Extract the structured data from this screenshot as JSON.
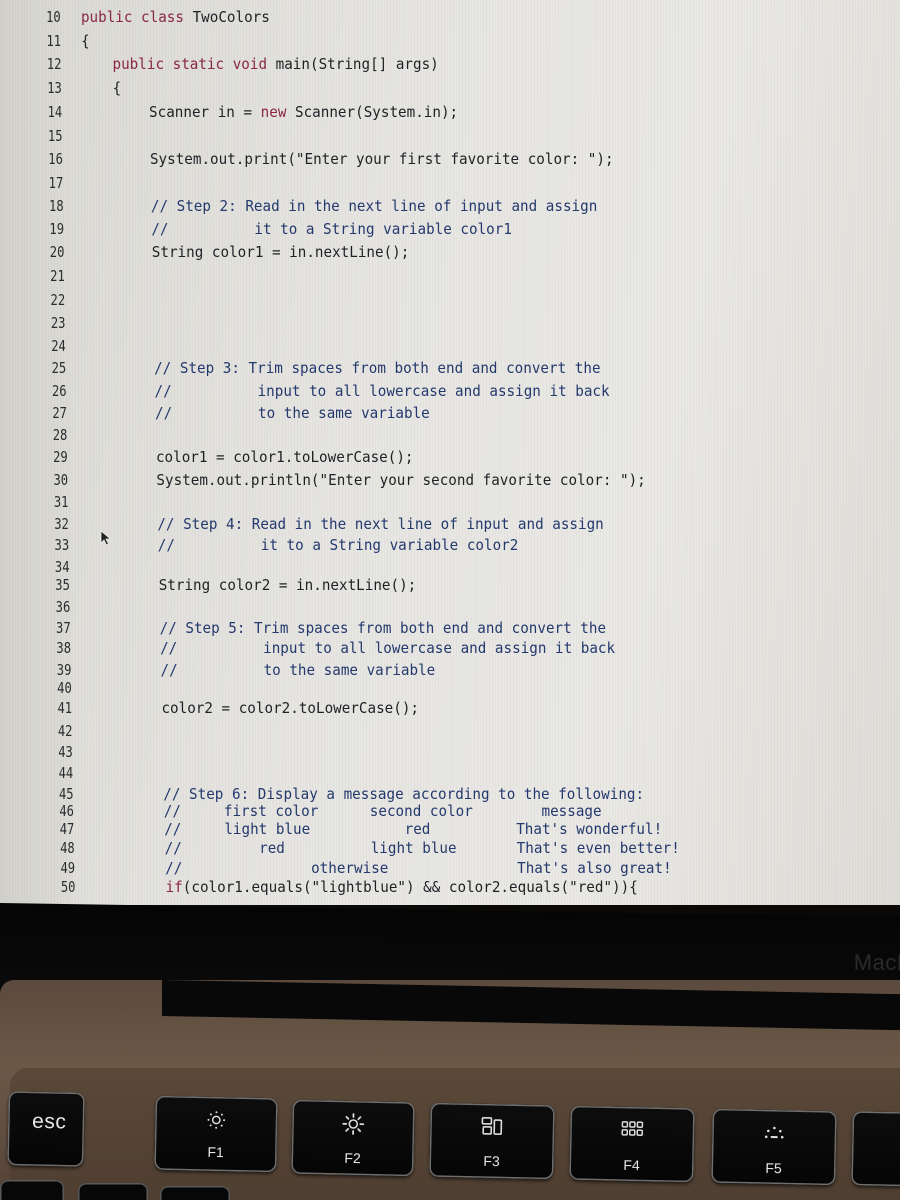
{
  "editor": {
    "language": "Java",
    "lines": [
      {
        "n": "10",
        "segments": [
          {
            "t": "public class ",
            "c": "kw"
          },
          {
            "t": "TwoColors",
            "c": "tx"
          }
        ],
        "indent": 0
      },
      {
        "n": "11",
        "segments": [
          {
            "t": "{",
            "c": "tx"
          }
        ],
        "indent": 0
      },
      {
        "n": "12",
        "segments": [
          {
            "t": "public static void ",
            "c": "kw"
          },
          {
            "t": "main(String[] args)",
            "c": "tx"
          }
        ],
        "indent": 1
      },
      {
        "n": "13",
        "segments": [
          {
            "t": "{",
            "c": "tx"
          }
        ],
        "indent": 1
      },
      {
        "n": "14",
        "segments": [
          {
            "t": "Scanner in = ",
            "c": "tx"
          },
          {
            "t": "new",
            "c": "kw"
          },
          {
            "t": " Scanner(System.in);",
            "c": "tx"
          }
        ],
        "indent": 2
      },
      {
        "n": "15",
        "segments": [],
        "indent": 2
      },
      {
        "n": "16",
        "segments": [
          {
            "t": "System.out.print(\"Enter your first favorite color: \");",
            "c": "tx"
          }
        ],
        "indent": 2
      },
      {
        "n": "17",
        "segments": [],
        "indent": 2
      },
      {
        "n": "18",
        "segments": [
          {
            "t": "// Step 2: Read in the next line of input and assign",
            "c": "cm"
          }
        ],
        "indent": 2
      },
      {
        "n": "19",
        "segments": [
          {
            "t": "//          it to a String variable color1",
            "c": "cm"
          }
        ],
        "indent": 2
      },
      {
        "n": "20",
        "segments": [
          {
            "t": "String color1 = in.nextLine();",
            "c": "tx"
          }
        ],
        "indent": 2
      },
      {
        "n": "21",
        "segments": [],
        "indent": 2
      },
      {
        "n": "22",
        "segments": [],
        "indent": 2
      },
      {
        "n": "23",
        "segments": [],
        "indent": 2
      },
      {
        "n": "24",
        "segments": [],
        "indent": 2
      },
      {
        "n": "25",
        "segments": [
          {
            "t": "// Step 3: Trim spaces from both end and convert the",
            "c": "cm"
          }
        ],
        "indent": 2
      },
      {
        "n": "26",
        "segments": [
          {
            "t": "//          input to all lowercase and assign it back",
            "c": "cm"
          }
        ],
        "indent": 2
      },
      {
        "n": "27",
        "segments": [
          {
            "t": "//          to the same variable",
            "c": "cm"
          }
        ],
        "indent": 2
      },
      {
        "n": "28",
        "segments": [],
        "indent": 2
      },
      {
        "n": "29",
        "segments": [
          {
            "t": "color1 = color1.toLowerCase();",
            "c": "tx"
          }
        ],
        "indent": 2
      },
      {
        "n": "30",
        "segments": [
          {
            "t": "System.out.println(\"Enter your second favorite color: \");",
            "c": "tx"
          }
        ],
        "indent": 2
      },
      {
        "n": "31",
        "segments": [],
        "indent": 2
      },
      {
        "n": "32",
        "segments": [
          {
            "t": "// Step 4: Read in the next line of input and assign",
            "c": "cm"
          }
        ],
        "indent": 2
      },
      {
        "n": "33",
        "segments": [
          {
            "t": "//          it to a String variable color2",
            "c": "cm"
          }
        ],
        "indent": 2
      },
      {
        "n": "34",
        "segments": [],
        "indent": 2
      },
      {
        "n": "35",
        "segments": [
          {
            "t": "String color2 = in.nextLine();",
            "c": "tx"
          }
        ],
        "indent": 2
      },
      {
        "n": "36",
        "segments": [],
        "indent": 2
      },
      {
        "n": "37",
        "segments": [
          {
            "t": "// Step 5: Trim spaces from both end and convert the",
            "c": "cm"
          }
        ],
        "indent": 2
      },
      {
        "n": "38",
        "segments": [
          {
            "t": "//          input to all lowercase and assign it back",
            "c": "cm"
          }
        ],
        "indent": 2
      },
      {
        "n": "39",
        "segments": [
          {
            "t": "//          to the same variable",
            "c": "cm"
          }
        ],
        "indent": 2
      },
      {
        "n": "40",
        "segments": [],
        "indent": 2
      },
      {
        "n": "41",
        "segments": [
          {
            "t": "color2 = color2.toLowerCase();",
            "c": "tx"
          }
        ],
        "indent": 2
      },
      {
        "n": "42",
        "segments": [],
        "indent": 2
      },
      {
        "n": "43",
        "segments": [],
        "indent": 2
      },
      {
        "n": "44",
        "segments": [],
        "indent": 2
      },
      {
        "n": "45",
        "segments": [
          {
            "t": "// Step 6: Display a message according to the following:",
            "c": "cm"
          }
        ],
        "indent": 2
      },
      {
        "n": "46",
        "segments": [
          {
            "t": "//     first color      second color        message",
            "c": "cm"
          }
        ],
        "indent": 2
      },
      {
        "n": "47",
        "segments": [
          {
            "t": "//     light blue           red          That's wonderful!",
            "c": "cm"
          }
        ],
        "indent": 2
      },
      {
        "n": "48",
        "segments": [
          {
            "t": "//         red          light blue       That's even better!",
            "c": "cm"
          }
        ],
        "indent": 2
      },
      {
        "n": "49",
        "segments": [
          {
            "t": "//               otherwise               That's also great!",
            "c": "cm"
          }
        ],
        "indent": 2
      },
      {
        "n": "50",
        "segments": [
          {
            "t": "if",
            "c": "kw"
          },
          {
            "t": "(color1.equals(\"lightblue\") && color2.equals(\"red\")){",
            "c": "tx"
          }
        ],
        "indent": 2
      }
    ]
  },
  "laptop": {
    "brand_text": "MacB"
  },
  "keyboard": {
    "keys": [
      {
        "id": "esc",
        "label": "esc",
        "icon": ""
      },
      {
        "id": "f1",
        "label": "F1",
        "icon": "brightness-down-icon"
      },
      {
        "id": "f2",
        "label": "F2",
        "icon": "brightness-up-icon"
      },
      {
        "id": "f3",
        "label": "F3",
        "icon": "mission-control-icon"
      },
      {
        "id": "f4",
        "label": "F4",
        "icon": "launchpad-icon"
      },
      {
        "id": "f5",
        "label": "F5",
        "icon": "keyboard-backlight-down-icon"
      }
    ]
  },
  "colors": {
    "keyword": "#8a2846",
    "comment": "#24396e",
    "text": "#1e2126",
    "editor_bg": "#e6e5e1"
  }
}
